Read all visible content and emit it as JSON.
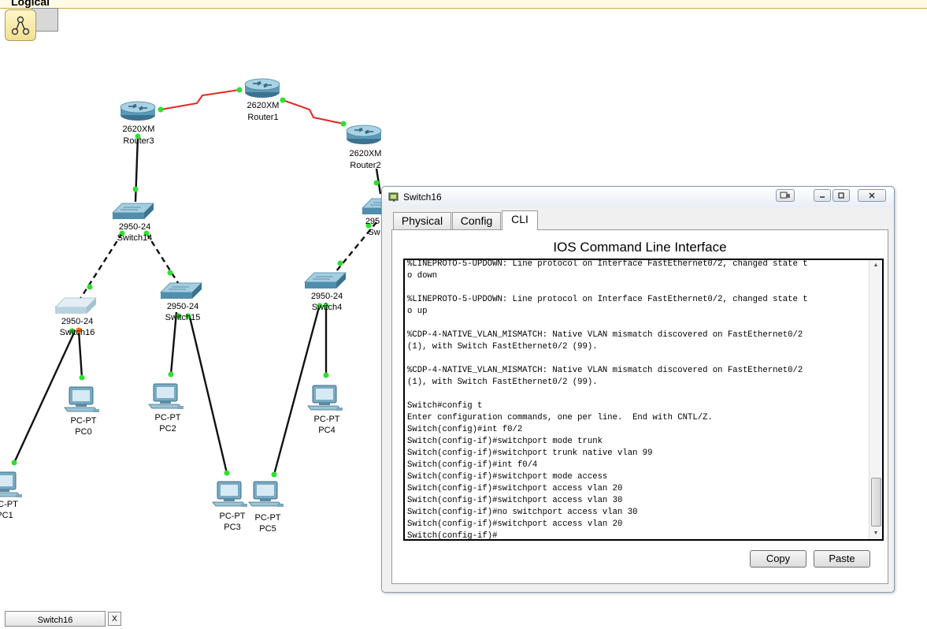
{
  "workspace": {
    "title": "Logical"
  },
  "topology": {
    "colors": {
      "link": "#111111",
      "serial": "#e0281e",
      "link_up": "#2ee02e",
      "link_down": "#ff6a00"
    },
    "devices": {
      "router1": {
        "model": "2620XM",
        "name": "Router1"
      },
      "router2": {
        "model": "2620XM",
        "name": "Router2"
      },
      "router3": {
        "model": "2620XM",
        "name": "Router3"
      },
      "switch14": {
        "model": "2950-24",
        "name": "Switch14"
      },
      "switch15": {
        "model": "2950-24",
        "name": "Switch15"
      },
      "switch16": {
        "model": "2950-24",
        "name": "Switch16"
      },
      "switch4": {
        "model": "2950-24",
        "name": "Switch4"
      },
      "switch_partial": {
        "model": "295",
        "name": "Sw"
      },
      "pc0": {
        "model": "PC-PT",
        "name": "PC0"
      },
      "pc1": {
        "model": "C-PT",
        "name": "PC1"
      },
      "pc2": {
        "model": "PC-PT",
        "name": "PC2"
      },
      "pc3": {
        "model": "PC-PT",
        "name": "PC3"
      },
      "pc4": {
        "model": "PC-PT",
        "name": "PC4"
      },
      "pc5": {
        "model": "PC-PT",
        "name": "PC5"
      }
    }
  },
  "window": {
    "title": "Switch16",
    "tabs": [
      {
        "label": "Physical"
      },
      {
        "label": "Config"
      },
      {
        "label": "CLI",
        "active": true
      }
    ],
    "cli": {
      "heading": "IOS Command Line Interface",
      "output": "%LINEPROTO-5-UPDOWN: Line protocol on Interface FastEthernet0/2, changed state t\no down\n\n%LINEPROTO-5-UPDOWN: Line protocol on Interface FastEthernet0/2, changed state t\no up\n\n%CDP-4-NATIVE_VLAN_MISMATCH: Native VLAN mismatch discovered on FastEthernet0/2\n(1), with Switch FastEthernet0/2 (99).\n\n%CDP-4-NATIVE_VLAN_MISMATCH: Native VLAN mismatch discovered on FastEthernet0/2\n(1), with Switch FastEthernet0/2 (99).\n\nSwitch#config t\nEnter configuration commands, one per line.  End with CNTL/Z.\nSwitch(config)#int f0/2\nSwitch(config-if)#switchport mode trunk\nSwitch(config-if)#switchport trunk native vlan 99\nSwitch(config-if)#int f0/4\nSwitch(config-if)#switchport mode access\nSwitch(config-if)#switchport access vlan 20\nSwitch(config-if)#switchport access vlan 30\nSwitch(config-if)#no switchport access vlan 30\nSwitch(config-if)#switchport access vlan 20\nSwitch(config-if)#",
      "copy_label": "Copy",
      "paste_label": "Paste"
    }
  },
  "taskbar": {
    "item_label": "Switch16",
    "close_label": "X"
  }
}
